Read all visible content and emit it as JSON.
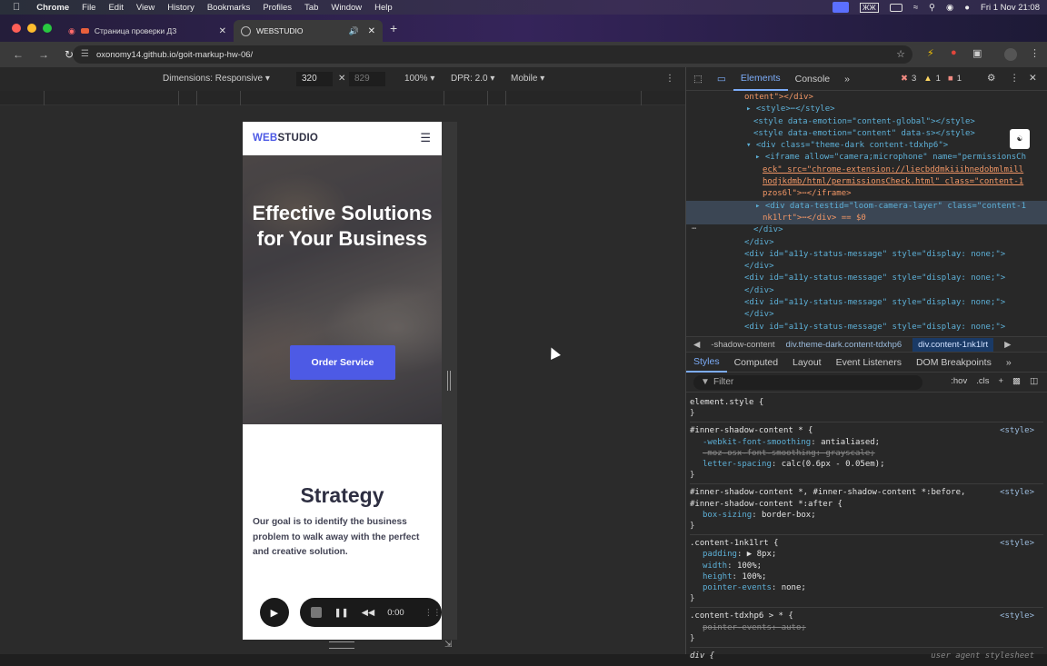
{
  "menubar": {
    "app": "Chrome",
    "items": [
      "File",
      "Edit",
      "View",
      "History",
      "Bookmarks",
      "Profiles",
      "Tab",
      "Window",
      "Help"
    ],
    "clock": "Fri 1 Nov  21:08",
    "input_source": "ЖЖ"
  },
  "tabs": [
    {
      "title": "Страница проверки ДЗ",
      "active": false
    },
    {
      "title": "WEBSTUDIO",
      "active": true
    }
  ],
  "address": {
    "url": "oxonomy14.github.io/goit-markup-hw-06/"
  },
  "device_toolbar": {
    "dimensions": "Dimensions: Responsive",
    "width": "320",
    "height": "829",
    "zoom": "100%",
    "dpr": "DPR: 2.0",
    "device": "Mobile"
  },
  "site": {
    "logo_accent": "WEB",
    "logo_rest": "STUDIO",
    "hero_title": "Effective Solutions for Your Business",
    "hero_button": "Order Service",
    "section_title": "Strategy",
    "section_text": "Our goal is to identify the business problem to walk away with the perfect and creative solution."
  },
  "loom": {
    "time": "0:00"
  },
  "devtools": {
    "tabs": [
      "Elements",
      "Console"
    ],
    "errors": "3",
    "warnings": "1",
    "issues": "1",
    "dom_lines": [
      "ontent\"></div>",
      "<style>⋯</style>",
      "<style data-emotion=\"content-global\"></style>",
      "<style data-emotion=\"content\" data-s></style>",
      "<div class=\"theme-dark content-tdxhp6\">",
      "<iframe allow=\"camera;microphone\" name=\"permissionsCh",
      "eck\" src=\"chrome-extension://liecbddmkiiihnedobmlmill",
      "hodjkdmb/html/permissionsCheck.html\" class=\"content-1",
      "pzos6l\">⋯</iframe>",
      "<div data-testid=\"loom-camera-layer\" class=\"content-1",
      "nk1lrt\">⋯</div> == $0",
      "</div>",
      "</div>",
      "<div id=\"a11y-status-message\" style=\"display: none;\">",
      "</div>",
      "<div id=\"a11y-status-message\" style=\"display: none;\">",
      "</div>",
      "<div id=\"a11y-status-message\" style=\"display: none;\">",
      "</div>",
      "<div id=\"a11y-status-message\" style=\"display: none;\">"
    ],
    "breadcrumbs": [
      "-shadow-content",
      "div.theme-dark.content-tdxhp6",
      "div.content-1nk1lrt"
    ],
    "subtabs": [
      "Styles",
      "Computed",
      "Layout",
      "Event Listeners",
      "DOM Breakpoints"
    ],
    "filter_placeholder": "Filter",
    "hov": ":hov",
    "cls": ".cls",
    "rules": [
      {
        "selector": "element.style {",
        "source": "",
        "props": [],
        "close": "}"
      },
      {
        "selector": "#inner-shadow-content * {",
        "source": "<style>",
        "props": [
          {
            "name": "-webkit-font-smoothing",
            "value": "antialiased;",
            "struck": false
          },
          {
            "name": "-moz-osx-font-smoothing",
            "value": "grayscale;",
            "struck": true
          },
          {
            "name": "letter-spacing",
            "value": "calc(0.6px - 0.05em);",
            "struck": false
          }
        ],
        "close": "}"
      },
      {
        "selector": "#inner-shadow-content *, #inner-shadow-content *:before,",
        "selector2": "#inner-shadow-content *:after {",
        "source": "<style>",
        "props": [
          {
            "name": "box-sizing",
            "value": "border-box;",
            "struck": false
          }
        ],
        "close": "}"
      },
      {
        "selector": ".content-1nk1lrt {",
        "source": "<style>",
        "props": [
          {
            "name": "padding",
            "value": "▶ 8px;",
            "struck": false
          },
          {
            "name": "width",
            "value": "100%;",
            "struck": false
          },
          {
            "name": "height",
            "value": "100%;",
            "struck": false
          },
          {
            "name": "pointer-events",
            "value": "none;",
            "struck": false
          }
        ],
        "close": "}"
      },
      {
        "selector": ".content-tdxhp6 > * {",
        "source": "<style>",
        "props": [
          {
            "name": "pointer-events",
            "value": "auto;",
            "struck": true
          }
        ],
        "close": "}"
      },
      {
        "selector": "div {",
        "source": "user agent stylesheet",
        "props": [],
        "close": ""
      }
    ]
  }
}
